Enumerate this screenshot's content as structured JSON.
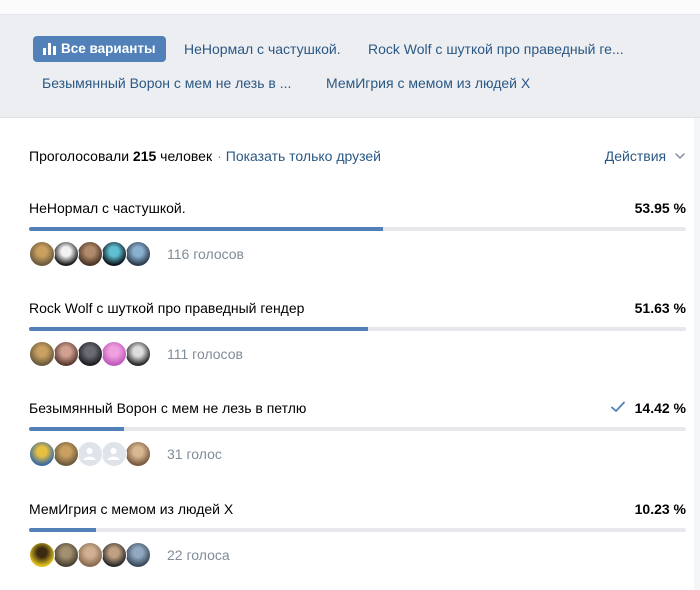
{
  "filters": {
    "active": "Все варианты",
    "items": [
      "НеНормал с частушкой.",
      "Rock Wolf с шуткой про праведный ге...",
      "Безымянный Ворон с мем не лезь в ...",
      "МемИгрия с мемом из людей Х"
    ]
  },
  "summary": {
    "prefix": "Проголосовали",
    "count": "215",
    "suffix": "человек",
    "separator": "·",
    "friends_link": "Показать только друзей"
  },
  "actions_label": "Действия",
  "colors": {
    "accent": "#5181b8",
    "link": "#2a5885",
    "muted": "#818c99",
    "track": "#e7e8ec"
  },
  "options": [
    {
      "label": "НеНормал с частушкой.",
      "percent_text": "53.95 %",
      "fill_percent": 53.95,
      "votes_text": "116 голосов",
      "voted": false,
      "avatars": [
        {
          "kind": "photo",
          "colors": [
            "#6b5a3c",
            "#c9a060"
          ]
        },
        {
          "kind": "photo",
          "colors": [
            "#1c1c1c",
            "#f2f2f2"
          ]
        },
        {
          "kind": "photo",
          "colors": [
            "#4a3526",
            "#b08a6a"
          ]
        },
        {
          "kind": "photo",
          "colors": [
            "#0e1620",
            "#5ec0d0"
          ]
        },
        {
          "kind": "photo",
          "colors": [
            "#2e3c4c",
            "#8ab0d0"
          ]
        }
      ]
    },
    {
      "label": "Rock Wolf с шуткой про праведный гендер",
      "percent_text": "51.63 %",
      "fill_percent": 51.63,
      "votes_text": "111 голосов",
      "voted": false,
      "avatars": [
        {
          "kind": "photo",
          "colors": [
            "#6b5a3c",
            "#c9a060"
          ]
        },
        {
          "kind": "photo",
          "colors": [
            "#5a3a30",
            "#d0a090"
          ]
        },
        {
          "kind": "photo",
          "colors": [
            "#1e1e24",
            "#6a6a74"
          ]
        },
        {
          "kind": "photo",
          "colors": [
            "#c05abb",
            "#f0a0e0"
          ]
        },
        {
          "kind": "photo",
          "colors": [
            "#2a2a2a",
            "#dedede"
          ]
        }
      ]
    },
    {
      "label": "Безымянный Ворон с мем не лезь в петлю",
      "percent_text": "14.42 %",
      "fill_percent": 14.42,
      "votes_text": "31 голос",
      "voted": true,
      "avatars": [
        {
          "kind": "photo",
          "colors": [
            "#3a6aa0",
            "#e8c040"
          ]
        },
        {
          "kind": "photo",
          "colors": [
            "#6b5a3c",
            "#c9a060"
          ]
        },
        {
          "kind": "blank",
          "colors": [
            "#dfe4ea",
            "#ffffff"
          ]
        },
        {
          "kind": "blank",
          "colors": [
            "#dfe4ea",
            "#ffffff"
          ]
        },
        {
          "kind": "photo",
          "colors": [
            "#7a5a40",
            "#d8b890"
          ]
        }
      ]
    },
    {
      "label": "МемИгрия с мемом из людей Х",
      "percent_text": "10.23 %",
      "fill_percent": 10.23,
      "votes_text": "22 голоса",
      "voted": false,
      "avatars": [
        {
          "kind": "photo",
          "colors": [
            "#e0c020",
            "#3a2a10"
          ]
        },
        {
          "kind": "photo",
          "colors": [
            "#4a4030",
            "#a09070"
          ]
        },
        {
          "kind": "photo",
          "colors": [
            "#8a6a50",
            "#d0b090"
          ]
        },
        {
          "kind": "photo",
          "colors": [
            "#2a2a2a",
            "#c0a080"
          ]
        },
        {
          "kind": "photo",
          "colors": [
            "#3a4a5a",
            "#90a8c0"
          ]
        }
      ]
    }
  ]
}
